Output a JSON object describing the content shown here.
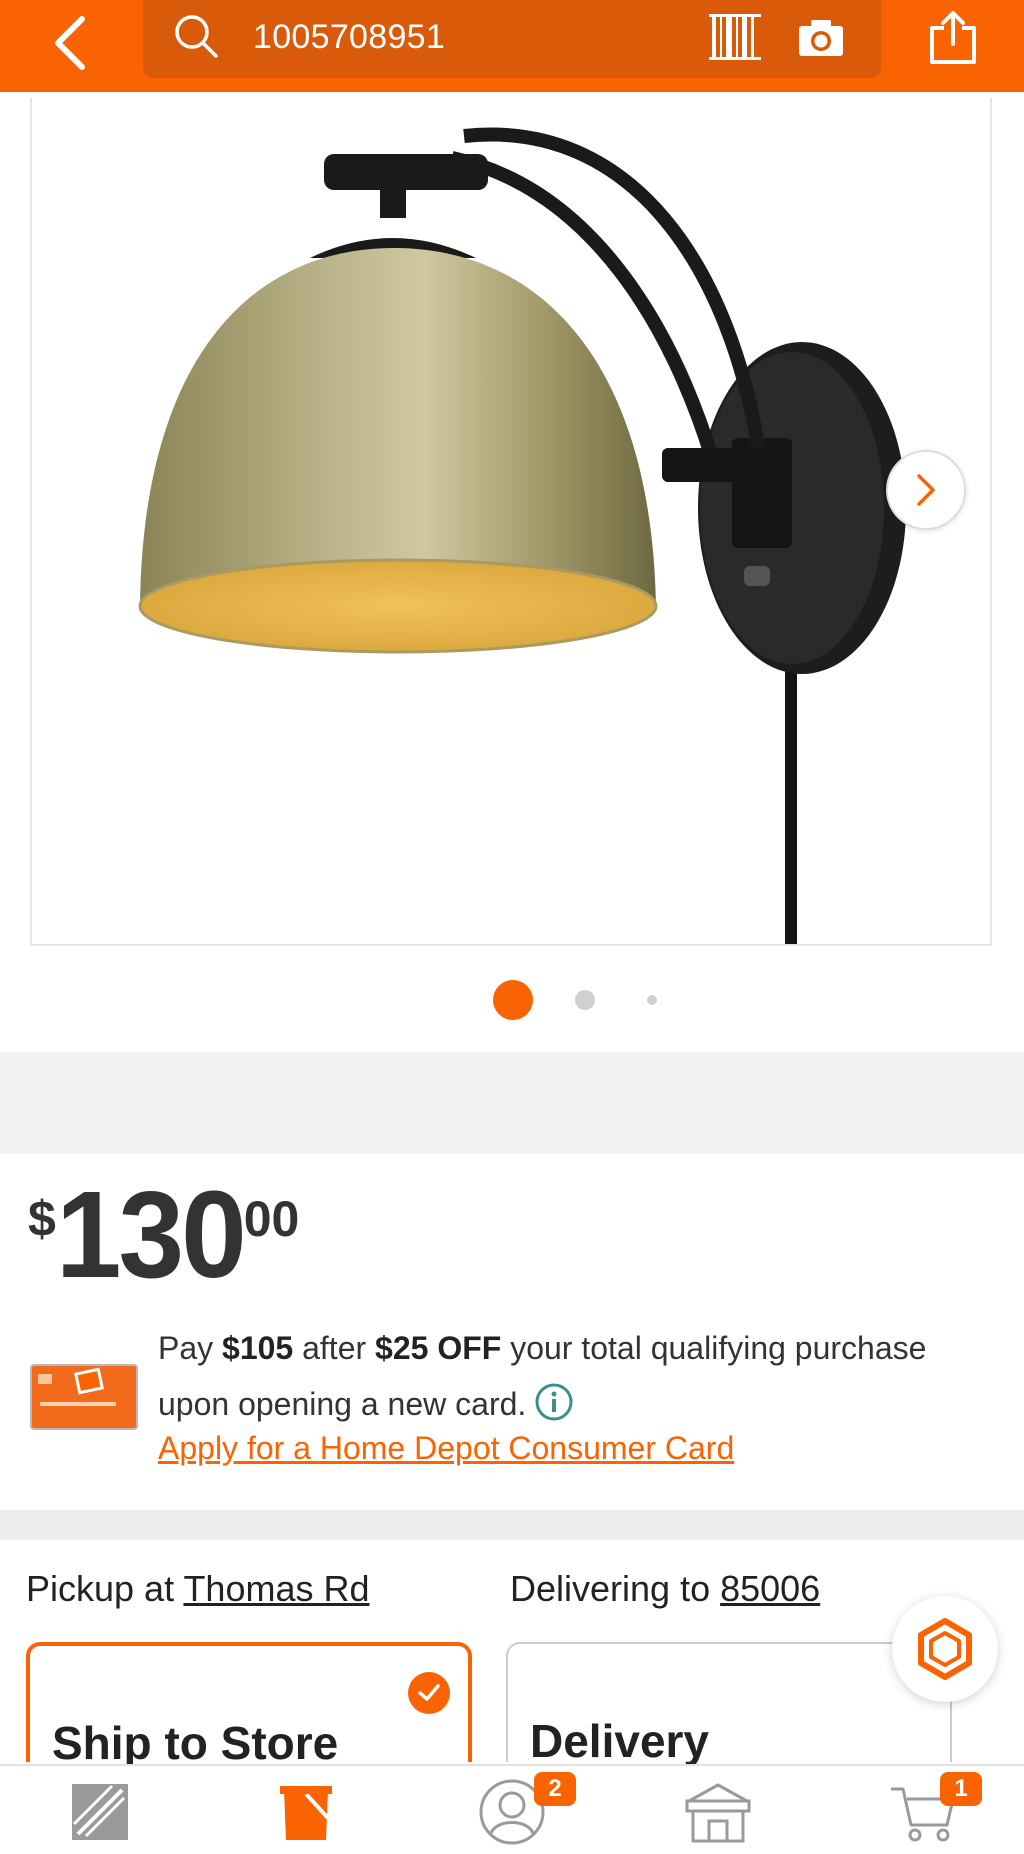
{
  "header": {
    "search_value": "1005708951",
    "icons": [
      "back-chevron-icon",
      "search-icon",
      "barcode-icon",
      "camera-icon",
      "share-icon"
    ],
    "accent_color": "#f96302"
  },
  "gallery": {
    "image_alt": "Wall lamp with brass dome shade and black swing arm",
    "current_slide": 1,
    "total_slides": 3
  },
  "price": {
    "currency": "$",
    "dollars": "130",
    "cents": "00"
  },
  "promo": {
    "pre": "Pay ",
    "amount": "$105",
    "mid": " after ",
    "discount": "$25 OFF",
    "post": " your total qualifying purchase upon opening a new card.",
    "link": "Apply for a Home Depot Consumer Card"
  },
  "fulfillment": {
    "pickup_prefix": "Pickup at ",
    "pickup_store": "Thomas Rd",
    "delivery_prefix": "Delivering to ",
    "delivery_zip": "85006",
    "ship_title": "Ship to Store",
    "delivery_title": "Delivery"
  },
  "bottom_nav": {
    "account_badge": "2",
    "cart_badge": "1"
  }
}
